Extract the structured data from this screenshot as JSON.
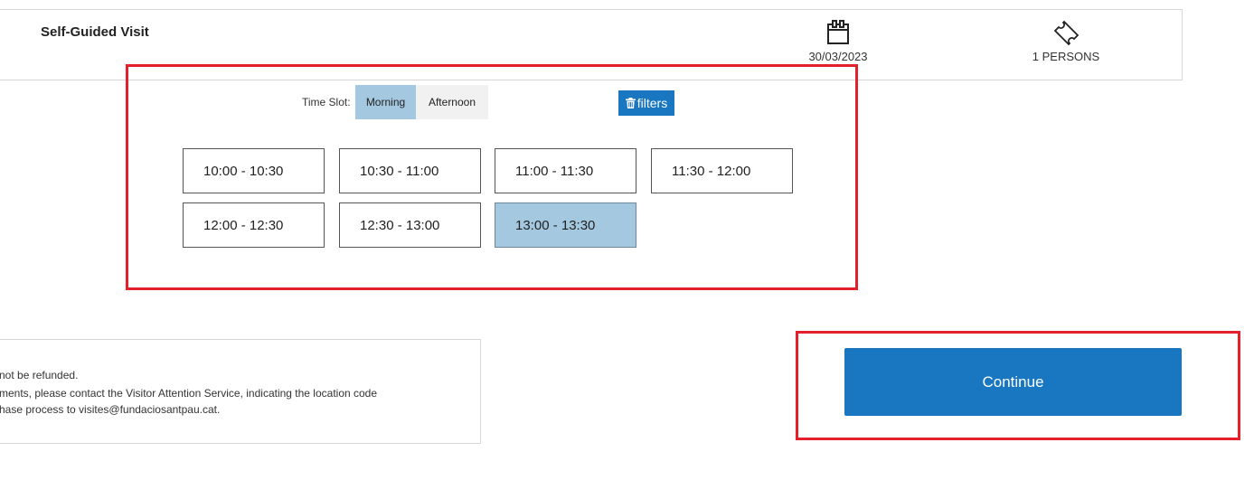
{
  "visit": {
    "title": "Self-Guided Visit",
    "date": "30/03/2023",
    "persons": "1 PERSONS",
    "date_icon": "calendar-icon",
    "persons_icon": "ticket-icon"
  },
  "time_slot": {
    "label": "Time Slot:",
    "options": [
      "Morning",
      "Afternoon"
    ],
    "selected": "Morning"
  },
  "filters": {
    "label": "filters",
    "icon": "trash-icon"
  },
  "slots": [
    "10:00 - 10:30",
    "10:30 - 11:00",
    "11:00 - 11:30",
    "11:30 - 12:00",
    "12:00 - 12:30",
    "12:30 - 13:00",
    "13:00 - 13:30"
  ],
  "selected_slot": "13:00 - 13:30",
  "notice": {
    "lines": [
      "not be refunded.",
      "ments, please contact the Visitor Attention Service, indicating the location code",
      "hase process to visites@fundaciosantpau.cat."
    ]
  },
  "continue": {
    "label": "Continue"
  },
  "colors": {
    "primary": "#1877c0",
    "selected": "#a3c8e0",
    "highlight": "#e3202b"
  }
}
